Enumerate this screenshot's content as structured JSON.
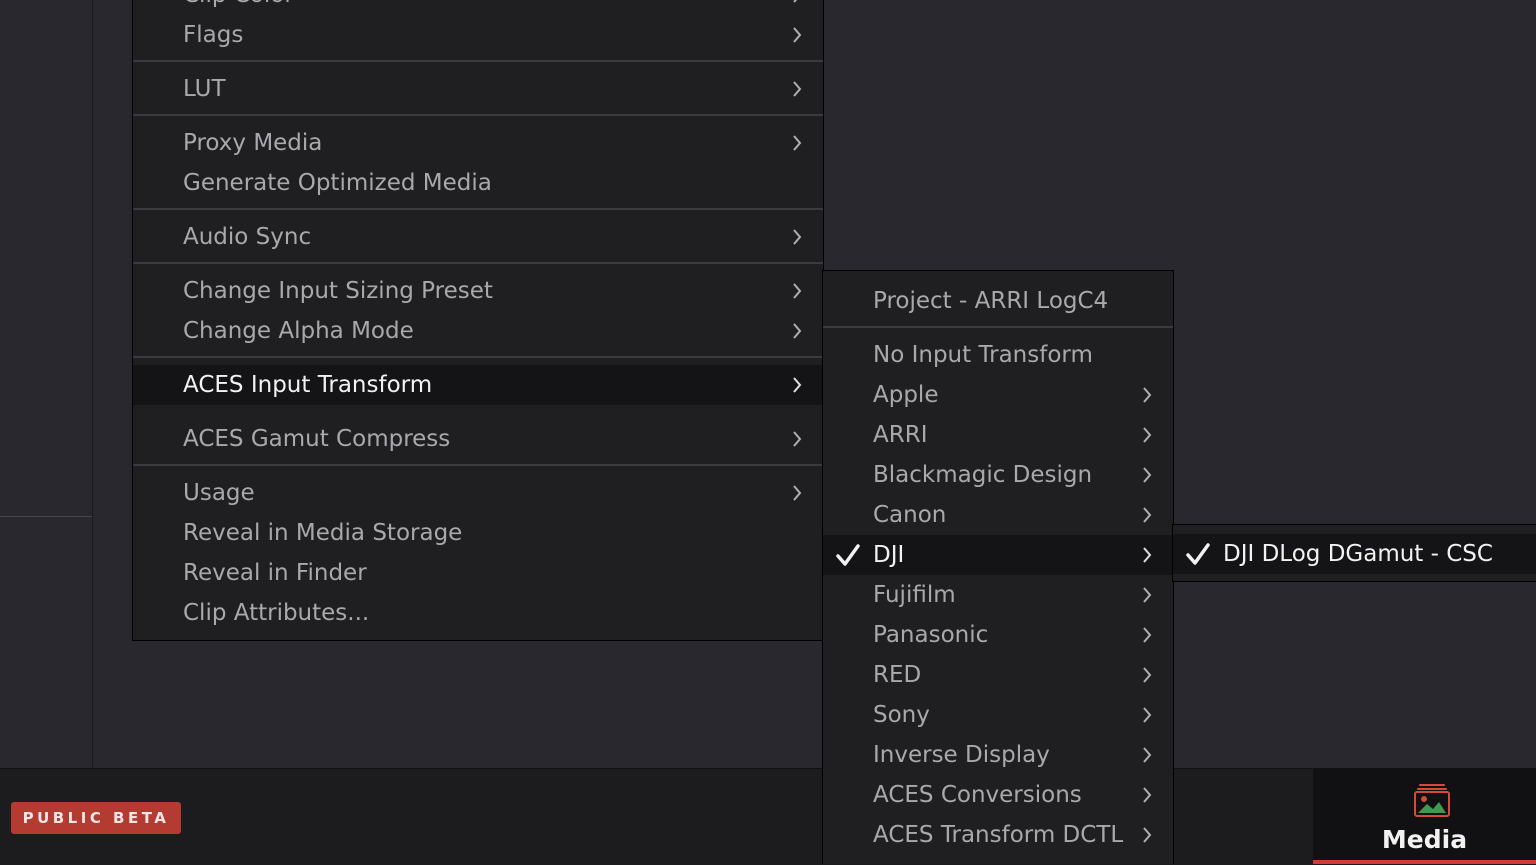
{
  "main_menu": {
    "items": [
      {
        "label": "Clip Color"
      },
      {
        "label": "Flags"
      },
      {
        "label": "LUT"
      },
      {
        "label": "Proxy Media"
      },
      {
        "label": "Generate Optimized Media"
      },
      {
        "label": "Audio Sync"
      },
      {
        "label": "Change Input Sizing Preset"
      },
      {
        "label": "Change Alpha Mode"
      },
      {
        "label": "ACES Input Transform"
      },
      {
        "label": "ACES Gamut Compress"
      },
      {
        "label": "Usage"
      },
      {
        "label": "Reveal in Media Storage"
      },
      {
        "label": "Reveal in Finder"
      },
      {
        "label": "Clip Attributes..."
      }
    ]
  },
  "aces_submenu": {
    "items": [
      {
        "label": "Project - ARRI LogC4"
      },
      {
        "label": "No Input Transform"
      },
      {
        "label": "Apple"
      },
      {
        "label": "ARRI"
      },
      {
        "label": "Blackmagic Design"
      },
      {
        "label": "Canon"
      },
      {
        "label": "DJI"
      },
      {
        "label": "Fujifilm"
      },
      {
        "label": "Panasonic"
      },
      {
        "label": "RED"
      },
      {
        "label": "Sony"
      },
      {
        "label": "Inverse Display"
      },
      {
        "label": "ACES Conversions"
      },
      {
        "label": "ACES Transform DCTL"
      }
    ]
  },
  "dji_submenu": {
    "items": [
      {
        "label": "DJI DLog DGamut - CSC"
      }
    ]
  },
  "bottom_bar": {
    "beta_badge": "PUBLIC BETA",
    "media_tab_label": "Media",
    "media_tab_icon": "media-pool-icon",
    "accent_color": "#d63a34",
    "badge_color": "#b33b32"
  }
}
